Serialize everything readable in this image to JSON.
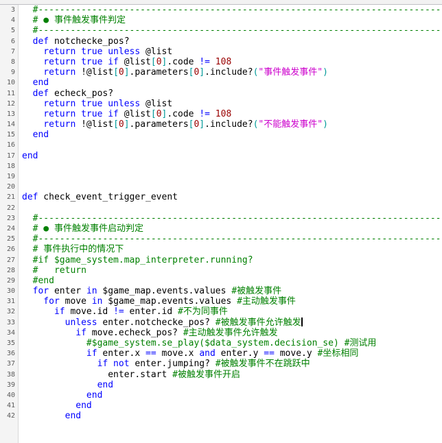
{
  "editor": {
    "language": "Ruby",
    "colors": {
      "background": "#ffffff",
      "gutter_background": "#f4f4f4",
      "gutter_text": "#5a5a5a",
      "plain_text": "#000000",
      "keyword": "#0000ff",
      "number": "#990000",
      "bracket": "#009999",
      "string": "#cc00cc",
      "comment": "#008000",
      "caret": "#000000"
    },
    "first_line_number": 3,
    "last_line_number": 42,
    "caret_line": 33
  },
  "lines": [
    {
      "n": "3",
      "tokens": [
        {
          "t": "cmt",
          "v": "  #----------------------------------------------------------------------------"
        }
      ]
    },
    {
      "n": "4",
      "tokens": [
        {
          "t": "cmt",
          "v": "  # ● 事件触发事件判定"
        }
      ]
    },
    {
      "n": "5",
      "tokens": [
        {
          "t": "cmt",
          "v": "  #----------------------------------------------------------------------------"
        }
      ]
    },
    {
      "n": "6",
      "tokens": [
        {
          "t": "kw",
          "v": "  def"
        },
        {
          "t": "pln",
          "v": " notchecke_pos?"
        }
      ]
    },
    {
      "n": "7",
      "tokens": [
        {
          "t": "kw",
          "v": "    return true unless "
        },
        {
          "t": "pln",
          "v": "@list"
        }
      ]
    },
    {
      "n": "8",
      "tokens": [
        {
          "t": "kw",
          "v": "    return true if "
        },
        {
          "t": "pln",
          "v": "@list"
        },
        {
          "t": "brk",
          "v": "["
        },
        {
          "t": "num",
          "v": "0"
        },
        {
          "t": "brk",
          "v": "]"
        },
        {
          "t": "pln",
          "v": ".code "
        },
        {
          "t": "kw",
          "v": "!="
        },
        {
          "t": "pln",
          "v": " "
        },
        {
          "t": "num",
          "v": "108"
        }
      ]
    },
    {
      "n": "9",
      "tokens": [
        {
          "t": "kw",
          "v": "    return "
        },
        {
          "t": "pln",
          "v": "!@list"
        },
        {
          "t": "brk",
          "v": "["
        },
        {
          "t": "num",
          "v": "0"
        },
        {
          "t": "brk",
          "v": "]"
        },
        {
          "t": "pln",
          "v": ".parameters"
        },
        {
          "t": "brk",
          "v": "["
        },
        {
          "t": "num",
          "v": "0"
        },
        {
          "t": "brk",
          "v": "]"
        },
        {
          "t": "pln",
          "v": ".include?"
        },
        {
          "t": "brk",
          "v": "("
        },
        {
          "t": "str",
          "v": "\"事件触发事件\""
        },
        {
          "t": "brk",
          "v": ")"
        }
      ]
    },
    {
      "n": "10",
      "tokens": [
        {
          "t": "kw",
          "v": "  end"
        }
      ]
    },
    {
      "n": "11",
      "tokens": [
        {
          "t": "kw",
          "v": "  def"
        },
        {
          "t": "pln",
          "v": " echeck_pos?"
        }
      ]
    },
    {
      "n": "12",
      "tokens": [
        {
          "t": "kw",
          "v": "    return true unless "
        },
        {
          "t": "pln",
          "v": "@list"
        }
      ]
    },
    {
      "n": "13",
      "tokens": [
        {
          "t": "kw",
          "v": "    return true if "
        },
        {
          "t": "pln",
          "v": "@list"
        },
        {
          "t": "brk",
          "v": "["
        },
        {
          "t": "num",
          "v": "0"
        },
        {
          "t": "brk",
          "v": "]"
        },
        {
          "t": "pln",
          "v": ".code "
        },
        {
          "t": "kw",
          "v": "!="
        },
        {
          "t": "pln",
          "v": " "
        },
        {
          "t": "num",
          "v": "108"
        }
      ]
    },
    {
      "n": "14",
      "tokens": [
        {
          "t": "kw",
          "v": "    return "
        },
        {
          "t": "pln",
          "v": "!@list"
        },
        {
          "t": "brk",
          "v": "["
        },
        {
          "t": "num",
          "v": "0"
        },
        {
          "t": "brk",
          "v": "]"
        },
        {
          "t": "pln",
          "v": ".parameters"
        },
        {
          "t": "brk",
          "v": "["
        },
        {
          "t": "num",
          "v": "0"
        },
        {
          "t": "brk",
          "v": "]"
        },
        {
          "t": "pln",
          "v": ".include?"
        },
        {
          "t": "brk",
          "v": "("
        },
        {
          "t": "str",
          "v": "\"不能触发事件\""
        },
        {
          "t": "brk",
          "v": ")"
        }
      ]
    },
    {
      "n": "15",
      "tokens": [
        {
          "t": "kw",
          "v": "  end"
        }
      ]
    },
    {
      "n": "16",
      "tokens": []
    },
    {
      "n": "17",
      "tokens": [
        {
          "t": "kw",
          "v": "end"
        }
      ]
    },
    {
      "n": "18",
      "tokens": []
    },
    {
      "n": "19",
      "tokens": []
    },
    {
      "n": "20",
      "tokens": []
    },
    {
      "n": "21",
      "tokens": [
        {
          "t": "kw",
          "v": "def"
        },
        {
          "t": "pln",
          "v": " check_event_trigger_event"
        }
      ]
    },
    {
      "n": "22",
      "tokens": []
    },
    {
      "n": "23",
      "tokens": [
        {
          "t": "cmt",
          "v": "  #----------------------------------------------------------------------------"
        }
      ]
    },
    {
      "n": "24",
      "tokens": [
        {
          "t": "cmt",
          "v": "  # ● 事件触发事件启动判定"
        }
      ]
    },
    {
      "n": "25",
      "tokens": [
        {
          "t": "cmt",
          "v": "  #----------------------------------------------------------------------------"
        }
      ]
    },
    {
      "n": "26",
      "tokens": [
        {
          "t": "cmt",
          "v": "  # 事件执行中的情况下"
        }
      ]
    },
    {
      "n": "27",
      "tokens": [
        {
          "t": "cmt",
          "v": "  #if $game_system.map_interpreter.running?"
        }
      ]
    },
    {
      "n": "28",
      "tokens": [
        {
          "t": "cmt",
          "v": "  #   return"
        }
      ]
    },
    {
      "n": "29",
      "tokens": [
        {
          "t": "cmt",
          "v": "  #end"
        }
      ]
    },
    {
      "n": "30",
      "tokens": [
        {
          "t": "kw",
          "v": "  for "
        },
        {
          "t": "pln",
          "v": "enter "
        },
        {
          "t": "kw",
          "v": "in "
        },
        {
          "t": "pln",
          "v": "$game_map.events.values "
        },
        {
          "t": "cmt",
          "v": "#被触发事件"
        }
      ]
    },
    {
      "n": "31",
      "tokens": [
        {
          "t": "kw",
          "v": "    for "
        },
        {
          "t": "pln",
          "v": "move "
        },
        {
          "t": "kw",
          "v": "in "
        },
        {
          "t": "pln",
          "v": "$game_map.events.values "
        },
        {
          "t": "cmt",
          "v": "#主动触发事件"
        }
      ]
    },
    {
      "n": "32",
      "tokens": [
        {
          "t": "kw",
          "v": "      if "
        },
        {
          "t": "pln",
          "v": "move.id "
        },
        {
          "t": "kw",
          "v": "!="
        },
        {
          "t": "pln",
          "v": " enter.id "
        },
        {
          "t": "cmt",
          "v": "#不为同事件"
        }
      ]
    },
    {
      "n": "33",
      "tokens": [
        {
          "t": "kw",
          "v": "        unless "
        },
        {
          "t": "pln",
          "v": "enter.notchecke_pos? "
        },
        {
          "t": "cmt",
          "v": "#被触发事件允许触发"
        }
      ],
      "caret": true
    },
    {
      "n": "34",
      "tokens": [
        {
          "t": "kw",
          "v": "          if "
        },
        {
          "t": "pln",
          "v": "move.echeck_pos? "
        },
        {
          "t": "cmt",
          "v": "#主动触发事件允许触发"
        }
      ]
    },
    {
      "n": "35",
      "tokens": [
        {
          "t": "cmt",
          "v": "            #$game_system.se_play($data_system.decision_se) #测试用"
        }
      ]
    },
    {
      "n": "36",
      "tokens": [
        {
          "t": "kw",
          "v": "            if "
        },
        {
          "t": "pln",
          "v": "enter.x "
        },
        {
          "t": "kw",
          "v": "=="
        },
        {
          "t": "pln",
          "v": " move.x "
        },
        {
          "t": "kw",
          "v": "and"
        },
        {
          "t": "pln",
          "v": " enter.y "
        },
        {
          "t": "kw",
          "v": "=="
        },
        {
          "t": "pln",
          "v": " move.y "
        },
        {
          "t": "cmt",
          "v": "#坐标相同"
        }
      ]
    },
    {
      "n": "37",
      "tokens": [
        {
          "t": "kw",
          "v": "              if not "
        },
        {
          "t": "pln",
          "v": "enter.jumping? "
        },
        {
          "t": "cmt",
          "v": "#被触发事件不在跳跃中"
        }
      ]
    },
    {
      "n": "38",
      "tokens": [
        {
          "t": "pln",
          "v": "                enter.start "
        },
        {
          "t": "cmt",
          "v": "#被触发事件开启"
        }
      ]
    },
    {
      "n": "39",
      "tokens": [
        {
          "t": "kw",
          "v": "              end"
        }
      ]
    },
    {
      "n": "40",
      "tokens": [
        {
          "t": "kw",
          "v": "            end"
        }
      ]
    },
    {
      "n": "41",
      "tokens": [
        {
          "t": "kw",
          "v": "          end"
        }
      ]
    },
    {
      "n": "42",
      "tokens": [
        {
          "t": "kw",
          "v": "        end"
        }
      ]
    }
  ]
}
